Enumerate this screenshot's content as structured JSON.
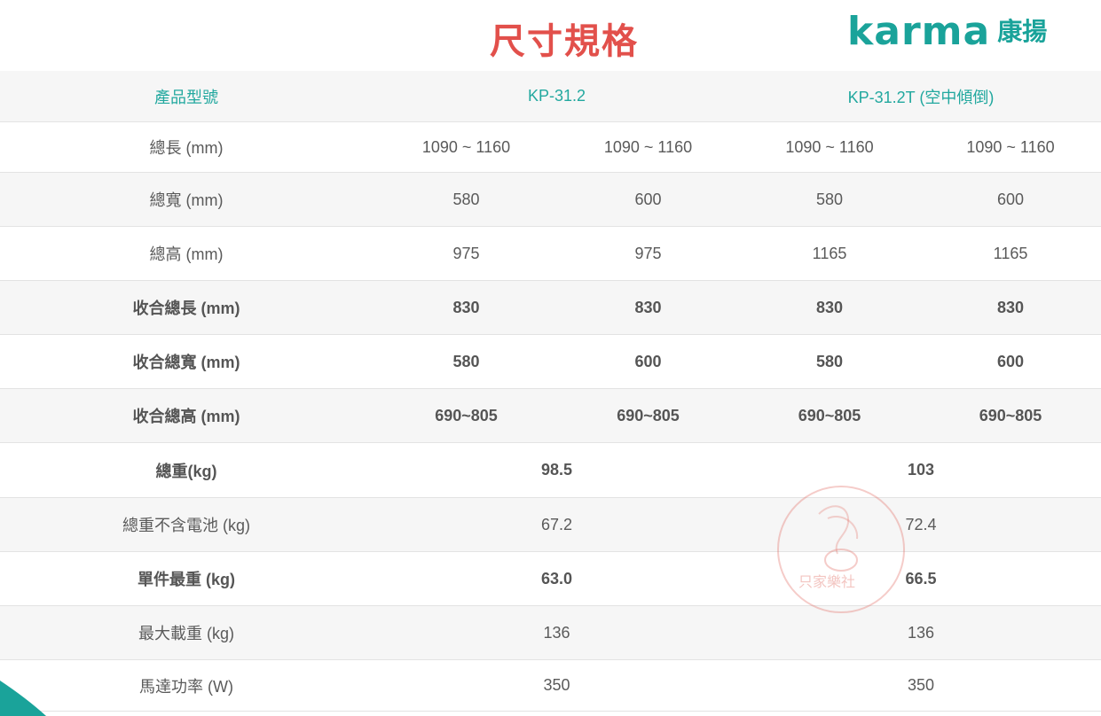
{
  "title": "尺寸規格",
  "brand": {
    "name": "karma",
    "cn": "康揚",
    "color": "#1aa39a"
  },
  "accent_title_color": "#e2504b",
  "table": {
    "header": {
      "label": "產品型號",
      "model_a": "KP-31.2",
      "model_b": "KP-31.2T (空中傾倒)"
    },
    "rows4": [
      {
        "label": "總長 (mm)",
        "values": [
          "1090 ~ 1160",
          "1090 ~ 1160",
          "1090 ~ 1160",
          "1090 ~ 1160"
        ]
      },
      {
        "label": "總寬 (mm)",
        "values": [
          "580",
          "600",
          "580",
          "600"
        ]
      },
      {
        "label": "總高 (mm)",
        "values": [
          "975",
          "975",
          "1165",
          "1165"
        ]
      },
      {
        "label": "收合總長 (mm)",
        "values": [
          "830",
          "830",
          "830",
          "830"
        ]
      },
      {
        "label": "收合總寬 (mm)",
        "values": [
          "580",
          "600",
          "580",
          "600"
        ]
      },
      {
        "label": "收合總高 (mm)",
        "values": [
          "690~805",
          "690~805",
          "690~805",
          "690~805"
        ]
      }
    ],
    "rows2": [
      {
        "label": "總重(kg)",
        "values": [
          "98.5",
          "103"
        ]
      },
      {
        "label": "總重不含電池 (kg)",
        "values": [
          "67.2",
          "72.4"
        ]
      },
      {
        "label": "單件最重 (kg)",
        "values": [
          "63.0",
          "66.5"
        ]
      },
      {
        "label": "最大載重 (kg)",
        "values": [
          "136",
          "136"
        ]
      },
      {
        "label": "馬達功率 (W)",
        "values": [
          "350",
          "350"
        ]
      }
    ]
  },
  "watermark": {
    "icon": "stamp-seal-icon",
    "text": "只家樂社"
  }
}
